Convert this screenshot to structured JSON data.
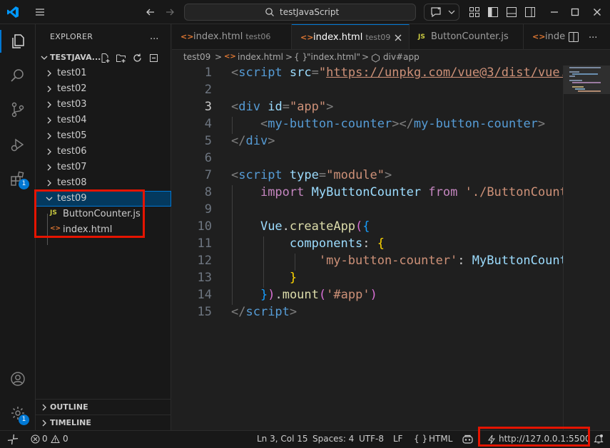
{
  "titlebar": {
    "search_text": "testJavaScript"
  },
  "activity": {
    "extensions_badge": "1",
    "settings_badge": "1"
  },
  "sidebar": {
    "title": "EXPLORER",
    "more": "...",
    "workspace": "TESTJAVA...",
    "folders": [
      "test01",
      "test02",
      "test03",
      "test04",
      "test05",
      "test06",
      "test07",
      "test08"
    ],
    "open_folder": "test09",
    "open_folder_files": [
      {
        "icon": "JS",
        "name": "ButtonCounter.js"
      },
      {
        "icon": "<>",
        "name": "index.html"
      }
    ],
    "outline_label": "OUTLINE",
    "timeline_label": "TIMELINE"
  },
  "tabs": [
    {
      "icon": "<>",
      "name": "index.html",
      "desc": "test06"
    },
    {
      "icon": "<>",
      "name": "index.html",
      "desc": "test09"
    },
    {
      "icon": "JS",
      "name": "ButtonCounter.js",
      "desc": ""
    },
    {
      "icon": "<>",
      "name": "inde",
      "desc": ""
    }
  ],
  "breadcrumb": {
    "folder": "test09",
    "file": "index.html",
    "node": "\"index.html\"",
    "element": "div#app",
    "sep": ">",
    "file_icon": "<>",
    "node_icon": "{ }"
  },
  "editor": {
    "line_numbers": [
      "1",
      "2",
      "3",
      "4",
      "5",
      "6",
      "7",
      "8",
      "9",
      "10",
      "11",
      "12",
      "13",
      "14",
      "15"
    ],
    "current_line": 3
  },
  "statusbar": {
    "errors": "0",
    "warnings": "0",
    "position": "Ln 3, Col 15",
    "spaces": "Spaces: 4",
    "encoding": "UTF-8",
    "eol": "LF",
    "language_icon": "{ }",
    "language": "HTML",
    "live_server": "http://127.0.0.1:5500"
  },
  "colors": {
    "accent": "#0078d4",
    "highlight_box": "#e51400",
    "editor_bg": "#1f1f1f",
    "chrome_bg": "#181818"
  }
}
